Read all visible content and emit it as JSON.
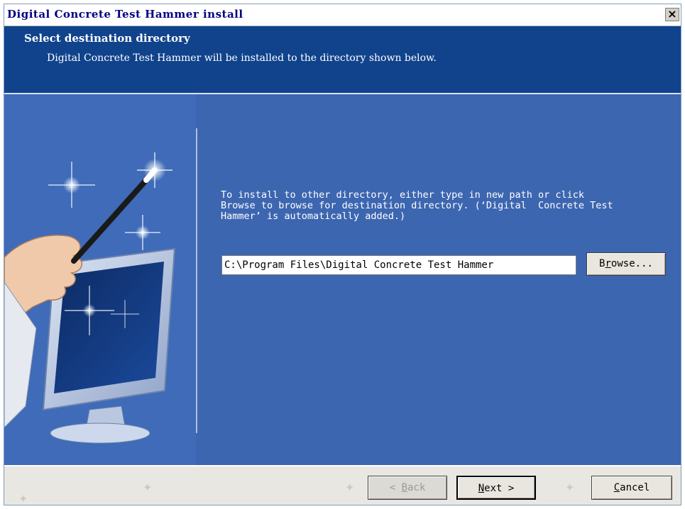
{
  "window": {
    "title": "Digital  Concrete Test Hammer install",
    "close_glyph": "×"
  },
  "header": {
    "title": "Select destination directory",
    "subtitle": "Digital  Concrete Test Hammer will be installed to the directory shown below."
  },
  "main": {
    "instruction_lines": [
      "To install to other directory, either type in new path or click",
      "Browse to browse for destination directory. (‘Digital  Concrete Test",
      "Hammer’ is automatically added.)"
    ],
    "path_value": "C:\\Program Files\\Digital  Concrete Test Hammer",
    "browse": {
      "pre": "B",
      "accel": "r",
      "post": "owse..."
    }
  },
  "footer": {
    "back": {
      "pre": "< ",
      "accel": "B",
      "post": "ack"
    },
    "next": {
      "pre": "",
      "accel": "N",
      "post": "ext >"
    },
    "cancel": {
      "pre": "",
      "accel": "C",
      "post": "ancel"
    }
  },
  "colors": {
    "header_bg": "#10438c",
    "body_bg": "#3d66b0",
    "title_text": "#000080"
  }
}
